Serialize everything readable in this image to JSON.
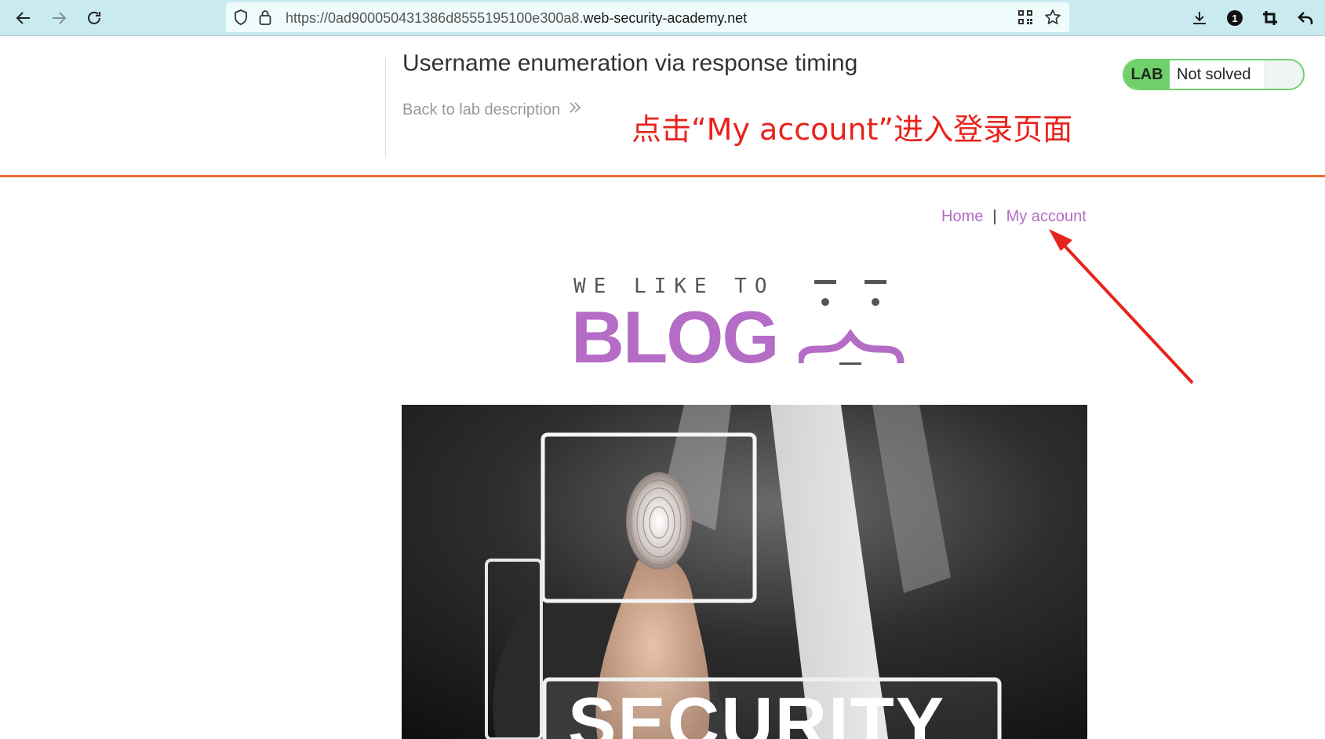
{
  "browser": {
    "url_prefix": "https://0ad900050431386d8555195100e300a8.",
    "url_host": "web-security-academy.net",
    "extensions_badge": "1"
  },
  "lab": {
    "title": "Username enumeration via response timing",
    "back_link": "Back to lab description",
    "badge": "LAB",
    "status": "Not solved",
    "status_color": "#70d16b"
  },
  "annotation": {
    "text": "点击“My account”进入登录页面",
    "color": "#e8231d"
  },
  "site_nav": {
    "home": "Home",
    "separator": "|",
    "my_account": "My account"
  },
  "logo": {
    "tagline": "WE LIKE TO",
    "word": "BLOG",
    "accent": "#b46cc6"
  },
  "hero": {
    "caption": "SECURITY"
  }
}
